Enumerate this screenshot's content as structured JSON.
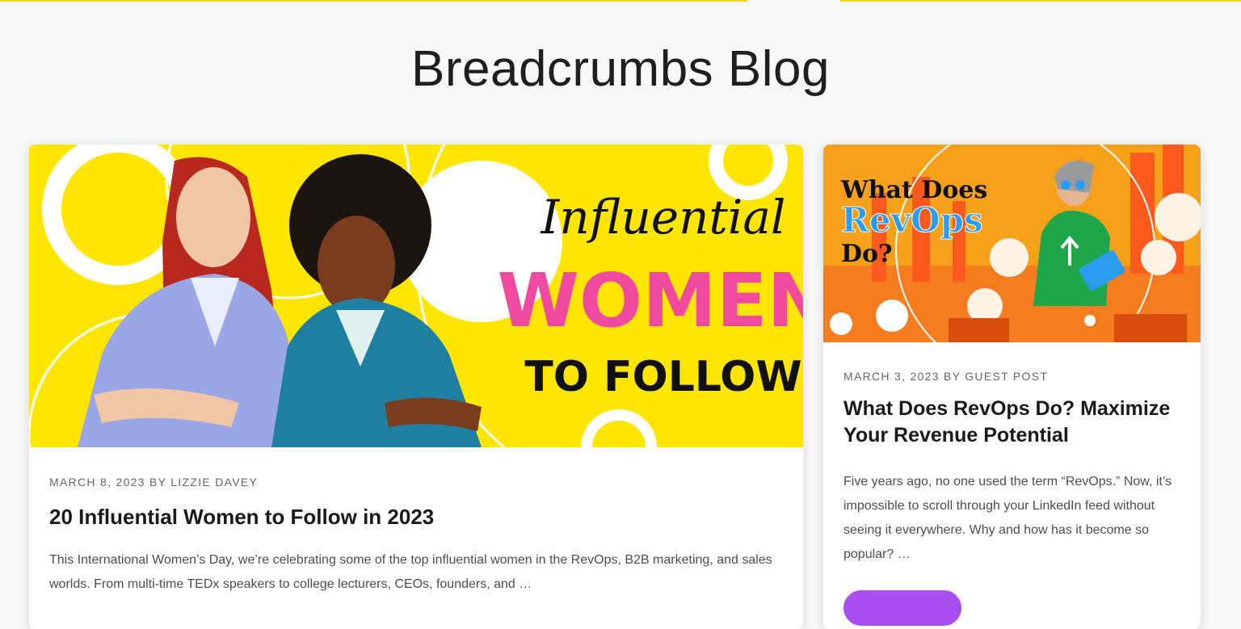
{
  "blog": {
    "title": "Breadcrumbs Blog"
  },
  "posts": [
    {
      "image_text": {
        "line1": "Influential",
        "line2": "WOMEN",
        "line3": "TO FOLLOW"
      },
      "meta": "MARCH 8, 2023 BY LIZZIE DAVEY",
      "title": "20 Influential Women to Follow in 2023",
      "excerpt": "This International Women’s Day, we’re celebrating some of the top influential women in the RevOps, B2B marketing, and sales worlds. From multi-time TEDx speakers to college lecturers, CEOs, founders, and …"
    },
    {
      "image_text": {
        "line1": "What Does",
        "line2": "RevOps",
        "line3": "Do?"
      },
      "meta": "MARCH 3, 2023 BY GUEST POST",
      "title": "What Does RevOps Do? Maximize Your Revenue Potential",
      "excerpt": "Five years ago, no one used the term “RevOps.” Now, it’s impossible to scroll through your LinkedIn feed without seeing it everywhere. Why and how has it become so popular? …",
      "button_label": ""
    }
  ],
  "colors": {
    "accent_yellow": "#ffe600",
    "pink": "#f04aa0",
    "blue": "#2a9df0",
    "orange": "#f57c1f",
    "button_purple": "#a94ef0"
  }
}
